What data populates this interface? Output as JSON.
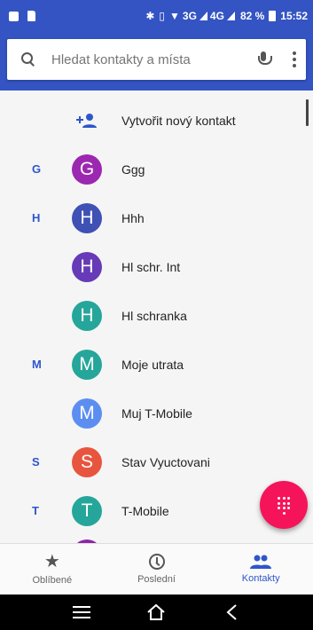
{
  "status_bar": {
    "network": "3G",
    "network2": "4G",
    "battery": "82 %",
    "time": "15:52"
  },
  "search": {
    "placeholder": "Hledat kontakty a místa"
  },
  "list": {
    "create_label": "Vytvořit nový kontakt",
    "contacts": [
      {
        "section": "G",
        "initial": "G",
        "name": "Ggg",
        "color": "#9c27b0"
      },
      {
        "section": "H",
        "initial": "H",
        "name": "Hhh",
        "color": "#3f51b5"
      },
      {
        "section": "",
        "initial": "H",
        "name": "Hl schr. Int",
        "color": "#673ab7"
      },
      {
        "section": "",
        "initial": "H",
        "name": "Hl schranka",
        "color": "#26a69a"
      },
      {
        "section": "M",
        "initial": "M",
        "name": "Moje utrata",
        "color": "#26a69a"
      },
      {
        "section": "",
        "initial": "M",
        "name": "Muj T-Mobile",
        "color": "#5c8ef2"
      },
      {
        "section": "S",
        "initial": "S",
        "name": "Stav Vyuctovani",
        "color": "#e8553e"
      },
      {
        "section": "T",
        "initial": "T",
        "name": "T-Mobile",
        "color": "#26a69a"
      }
    ]
  },
  "tabs": [
    {
      "label": "Oblíbené",
      "icon": "star-icon",
      "active": false
    },
    {
      "label": "Poslední",
      "icon": "clock-icon",
      "active": false
    },
    {
      "label": "Kontakty",
      "icon": "people-icon",
      "active": true
    }
  ],
  "colors": {
    "accent": "#3454c3",
    "fab": "#f5145a"
  }
}
